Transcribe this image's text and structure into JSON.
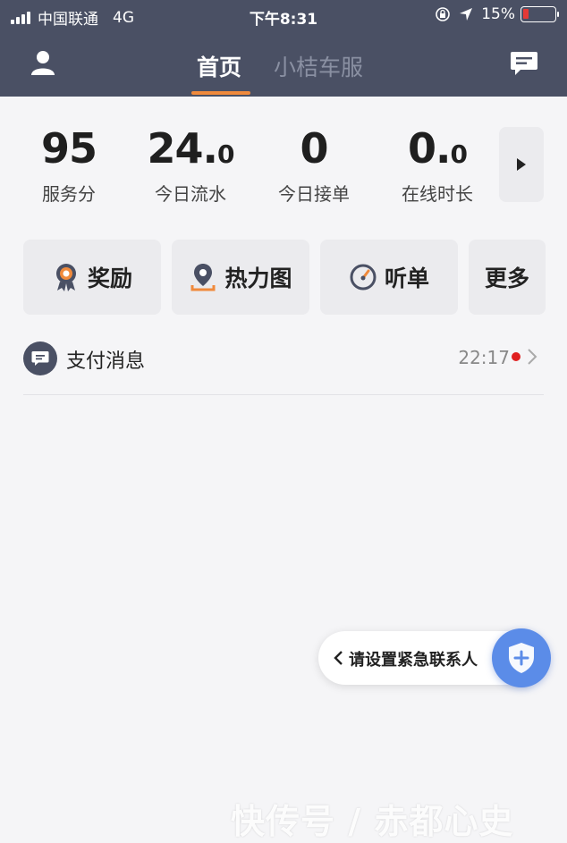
{
  "status_bar": {
    "carrier": "中国联通",
    "network": "4G",
    "time": "下午8:31",
    "battery": "15%"
  },
  "nav": {
    "tabs": [
      {
        "label": "首页",
        "active": true
      },
      {
        "label": "小桔车服",
        "active": false
      }
    ],
    "left_icon": "user-icon",
    "right_icon": "message-icon"
  },
  "stats": [
    {
      "value_int": "95",
      "value_dec": "",
      "label": "服务分"
    },
    {
      "value_int": "24.",
      "value_dec": "0",
      "label": "今日流水"
    },
    {
      "value_int": "0",
      "value_dec": "",
      "label": "今日接单"
    },
    {
      "value_int": "0.",
      "value_dec": "0",
      "label": "在线时长"
    }
  ],
  "actions": [
    {
      "label": "奖励",
      "icon": "medal-icon"
    },
    {
      "label": "热力图",
      "icon": "location-pin-icon"
    },
    {
      "label": "听单",
      "icon": "speedometer-icon"
    },
    {
      "label": "更多",
      "icon": ""
    }
  ],
  "message": {
    "title": "支付消息",
    "time": "22:17",
    "unread": true,
    "icon": "chat-bubble-icon"
  },
  "emergency": {
    "label": "请设置紧急联系人",
    "icon": "shield-plus-icon"
  },
  "watermark": "快传号 / 赤都心史",
  "colors": {
    "header": "#4a5064",
    "accent": "#f08a3c",
    "unread_dot": "#e02020",
    "shield": "#5b8ce8"
  }
}
